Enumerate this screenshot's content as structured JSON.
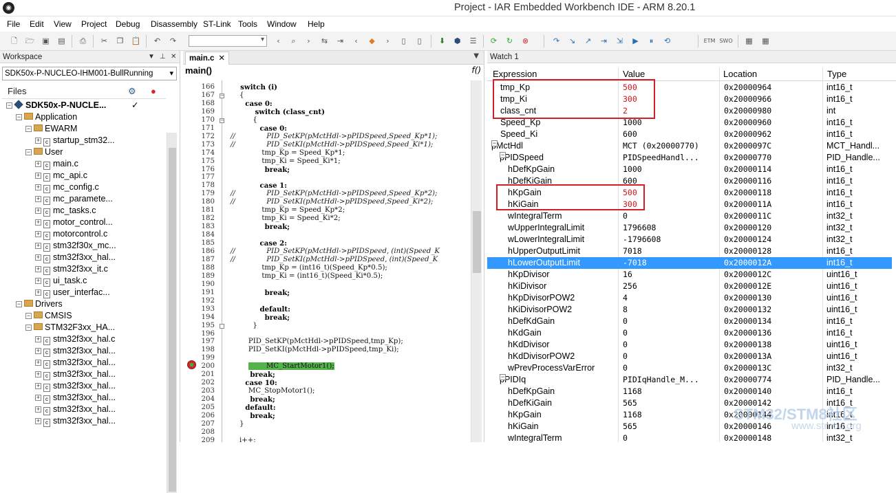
{
  "app": {
    "title": "Project - IAR Embedded Workbench IDE - ARM 8.20.1"
  },
  "menu": [
    "File",
    "Edit",
    "View",
    "Project",
    "Debug",
    "Disassembly",
    "ST-Link",
    "Tools",
    "Window",
    "Help"
  ],
  "workspace": {
    "title": "Workspace",
    "config": "SDK50x-P-NUCLEO-IHM001-BullRunning",
    "files_label": "Files",
    "tree": [
      {
        "label": "SDK50x-P-NUCLE...",
        "kind": "project",
        "check": "✓"
      },
      {
        "label": "Application",
        "kind": "folder"
      },
      {
        "label": "EWARM",
        "kind": "folder"
      },
      {
        "label": "startup_stm32...",
        "kind": "file"
      },
      {
        "label": "User",
        "kind": "folder"
      },
      {
        "label": "main.c",
        "kind": "file"
      },
      {
        "label": "mc_api.c",
        "kind": "file"
      },
      {
        "label": "mc_config.c",
        "kind": "file"
      },
      {
        "label": "mc_paramete...",
        "kind": "file"
      },
      {
        "label": "mc_tasks.c",
        "kind": "file"
      },
      {
        "label": "motor_control...",
        "kind": "file"
      },
      {
        "label": "motorcontrol.c",
        "kind": "file"
      },
      {
        "label": "stm32f30x_mc...",
        "kind": "file"
      },
      {
        "label": "stm32f3xx_hal...",
        "kind": "file"
      },
      {
        "label": "stm32f3xx_it.c",
        "kind": "file"
      },
      {
        "label": "ui_task.c",
        "kind": "file"
      },
      {
        "label": "user_interfac...",
        "kind": "file"
      },
      {
        "label": "Drivers",
        "kind": "folder"
      },
      {
        "label": "CMSIS",
        "kind": "folder"
      },
      {
        "label": "STM32F3xx_HA...",
        "kind": "folder"
      },
      {
        "label": "stm32f3xx_hal.c",
        "kind": "file"
      },
      {
        "label": "stm32f3xx_hal...",
        "kind": "file"
      },
      {
        "label": "stm32f3xx_hal...",
        "kind": "file"
      },
      {
        "label": "stm32f3xx_hal...",
        "kind": "file"
      },
      {
        "label": "stm32f3xx_hal...",
        "kind": "file"
      },
      {
        "label": "stm32f3xx_hal...",
        "kind": "file"
      },
      {
        "label": "stm32f3xx_hal...",
        "kind": "file"
      },
      {
        "label": "stm32f3xx_hal...",
        "kind": "file"
      }
    ]
  },
  "editor": {
    "tab": "main.c",
    "function": "main()",
    "fx": "f()",
    "lines": [
      {
        "n": "166",
        "t": "    switch (i)",
        "k": "kw"
      },
      {
        "n": "167",
        "t": "    {"
      },
      {
        "n": "168",
        "t": "      case 0:",
        "k": "kw"
      },
      {
        "n": "169",
        "t": "          switch (class_cnt)",
        "k": "kw"
      },
      {
        "n": "170",
        "t": "          {"
      },
      {
        "n": "171",
        "t": "            case 0:",
        "k": "kw"
      },
      {
        "n": "172",
        "t": "//              PID_SetKP(pMctHdl->pPIDSpeed,Speed_Kp*1);",
        "k": "cm"
      },
      {
        "n": "173",
        "t": "//              PID_SetKI(pMctHdl->pPIDSpeed,Speed_Ki*1);",
        "k": "cm"
      },
      {
        "n": "174",
        "t": "              tmp_Kp = Speed_Kp*1;"
      },
      {
        "n": "175",
        "t": "              tmp_Ki = Speed_Ki*1;"
      },
      {
        "n": "176",
        "t": "              break;",
        "k": "kw"
      },
      {
        "n": "177",
        "t": ""
      },
      {
        "n": "178",
        "t": "            case 1:",
        "k": "kw"
      },
      {
        "n": "179",
        "t": "//              PID_SetKP(pMctHdl->pPIDSpeed,Speed_Kp*2);",
        "k": "cm"
      },
      {
        "n": "180",
        "t": "//              PID_SetKI(pMctHdl->pPIDSpeed,Speed_Ki*2);",
        "k": "cm"
      },
      {
        "n": "181",
        "t": "              tmp_Kp = Speed_Kp*2;"
      },
      {
        "n": "182",
        "t": "              tmp_Ki = Speed_Ki*2;"
      },
      {
        "n": "183",
        "t": "              break;",
        "k": "kw"
      },
      {
        "n": "184",
        "t": ""
      },
      {
        "n": "185",
        "t": "            case 2:",
        "k": "kw"
      },
      {
        "n": "186",
        "t": "//              PID_SetKP(pMctHdl->pPIDSpeed, (int)(Speed_K",
        "k": "cm"
      },
      {
        "n": "187",
        "t": "//              PID_SetKI(pMctHdl->pPIDSpeed, (int)(Speed_K",
        "k": "cm"
      },
      {
        "n": "188",
        "t": "              tmp_Kp = (int16_t)(Speed_Kp*0.5);"
      },
      {
        "n": "189",
        "t": "              tmp_Ki = (int16_t)(Speed_Ki*0.5);"
      },
      {
        "n": "190",
        "t": ""
      },
      {
        "n": "191",
        "t": "              break;",
        "k": "kw"
      },
      {
        "n": "192",
        "t": ""
      },
      {
        "n": "193",
        "t": "            default:",
        "k": "kw"
      },
      {
        "n": "194",
        "t": "              break;",
        "k": "kw"
      },
      {
        "n": "195",
        "t": "          }"
      },
      {
        "n": "196",
        "t": ""
      },
      {
        "n": "197",
        "t": "        PID_SetKP(pMctHdl->pPIDSpeed,tmp_Kp);"
      },
      {
        "n": "198",
        "t": "        PID_SetKI(pMctHdl->pPIDSpeed,tmp_Ki);"
      },
      {
        "n": "199",
        "t": ""
      },
      {
        "n": "200",
        "t": "        MC_StartMotor1();",
        "k": "hl"
      },
      {
        "n": "201",
        "t": "        break;",
        "k": "kw"
      },
      {
        "n": "202",
        "t": "      case 10:",
        "k": "kw"
      },
      {
        "n": "203",
        "t": "        MC_StopMotor1();"
      },
      {
        "n": "204",
        "t": "        break;",
        "k": "kw"
      },
      {
        "n": "205",
        "t": "      default:",
        "k": "kw"
      },
      {
        "n": "206",
        "t": "        break;",
        "k": "kw"
      },
      {
        "n": "207",
        "t": "    }"
      },
      {
        "n": "208",
        "t": ""
      },
      {
        "n": "209",
        "t": "    i++;"
      }
    ]
  },
  "watch": {
    "title": "Watch 1",
    "columns": [
      "Expression",
      "Value",
      "Location",
      "Type"
    ],
    "rows": [
      {
        "expr": "tmp_Kp",
        "value": "500",
        "loc": "0x20000964",
        "type": "int16_t",
        "red": true
      },
      {
        "expr": "tmp_Ki",
        "value": "300",
        "loc": "0x20000966",
        "type": "int16_t",
        "red": true
      },
      {
        "expr": "class_cnt",
        "value": "2",
        "loc": "0x20000980",
        "type": "int",
        "red": true
      },
      {
        "expr": "Speed_Kp",
        "value": "1000",
        "loc": "0x20000960",
        "type": "int16_t"
      },
      {
        "expr": "Speed_Ki",
        "value": "600",
        "loc": "0x20000962",
        "type": "int16_t"
      },
      {
        "expr": "pMctHdl",
        "value": "MCT (0x20000770)",
        "loc": "0x2000097C",
        "type": "MCT_Handl...",
        "exp": "⊟",
        "lvl": 0
      },
      {
        "expr": "pPIDSpeed",
        "value": "PIDSpeedHandl...",
        "loc": "0x20000770",
        "type": "PID_Handle...",
        "exp": "⊟",
        "lvl": 1
      },
      {
        "expr": "hDefKpGain",
        "value": "1000",
        "loc": "0x20000114",
        "type": "int16_t",
        "lvl": 2
      },
      {
        "expr": "hDefKiGain",
        "value": "600",
        "loc": "0x20000116",
        "type": "int16_t",
        "lvl": 2
      },
      {
        "expr": "hKpGain",
        "value": "500",
        "loc": "0x20000118",
        "type": "int16_t",
        "lvl": 2,
        "red": true
      },
      {
        "expr": "hKiGain",
        "value": "300",
        "loc": "0x2000011A",
        "type": "int16_t",
        "lvl": 2,
        "red": true
      },
      {
        "expr": "wIntegralTerm",
        "value": "0",
        "loc": "0x2000011C",
        "type": "int32_t",
        "lvl": 2
      },
      {
        "expr": "wUpperIntegralLimit",
        "value": "1796608",
        "loc": "0x20000120",
        "type": "int32_t",
        "lvl": 2
      },
      {
        "expr": "wLowerIntegralLimit",
        "value": "-1796608",
        "loc": "0x20000124",
        "type": "int32_t",
        "lvl": 2
      },
      {
        "expr": "hUpperOutputLimit",
        "value": "7018",
        "loc": "0x20000128",
        "type": "int16_t",
        "lvl": 2
      },
      {
        "expr": "hLowerOutputLimit",
        "value": "-7018",
        "loc": "0x2000012A",
        "type": "int16_t",
        "lvl": 2,
        "sel": true
      },
      {
        "expr": "hKpDivisor",
        "value": "16",
        "loc": "0x2000012C",
        "type": "uint16_t",
        "lvl": 2
      },
      {
        "expr": "hKiDivisor",
        "value": "256",
        "loc": "0x2000012E",
        "type": "uint16_t",
        "lvl": 2
      },
      {
        "expr": "hKpDivisorPOW2",
        "value": "4",
        "loc": "0x20000130",
        "type": "uint16_t",
        "lvl": 2
      },
      {
        "expr": "hKiDivisorPOW2",
        "value": "8",
        "loc": "0x20000132",
        "type": "uint16_t",
        "lvl": 2
      },
      {
        "expr": "hDefKdGain",
        "value": "0",
        "loc": "0x20000134",
        "type": "int16_t",
        "lvl": 2
      },
      {
        "expr": "hKdGain",
        "value": "0",
        "loc": "0x20000136",
        "type": "int16_t",
        "lvl": 2
      },
      {
        "expr": "hKdDivisor",
        "value": "0",
        "loc": "0x20000138",
        "type": "uint16_t",
        "lvl": 2
      },
      {
        "expr": "hKdDivisorPOW2",
        "value": "0",
        "loc": "0x2000013A",
        "type": "uint16_t",
        "lvl": 2
      },
      {
        "expr": "wPrevProcessVarError",
        "value": "0",
        "loc": "0x2000013C",
        "type": "int32_t",
        "lvl": 2
      },
      {
        "expr": "pPIDIq",
        "value": "PIDIqHandle_M...",
        "loc": "0x20000774",
        "type": "PID_Handle...",
        "exp": "⊟",
        "lvl": 1
      },
      {
        "expr": "hDefKpGain",
        "value": "1168",
        "loc": "0x20000140",
        "type": "int16_t",
        "lvl": 2
      },
      {
        "expr": "hDefKiGain",
        "value": "565",
        "loc": "0x20000142",
        "type": "int16_t",
        "lvl": 2
      },
      {
        "expr": "hKpGain",
        "value": "1168",
        "loc": "0x20000144",
        "type": "int16_t",
        "lvl": 2
      },
      {
        "expr": "hKiGain",
        "value": "565",
        "loc": "0x20000146",
        "type": "int16_t",
        "lvl": 2
      },
      {
        "expr": "wIntegralTerm",
        "value": "0",
        "loc": "0x20000148",
        "type": "int32_t",
        "lvl": 2
      }
    ]
  },
  "watermark": {
    "line1": "STM32/STM8社区",
    "line2": "www.stmcu.org"
  },
  "colors": {
    "highlight_red": "#d0121b",
    "selection": "#3399ff",
    "code_highlight": "#53b34a"
  }
}
